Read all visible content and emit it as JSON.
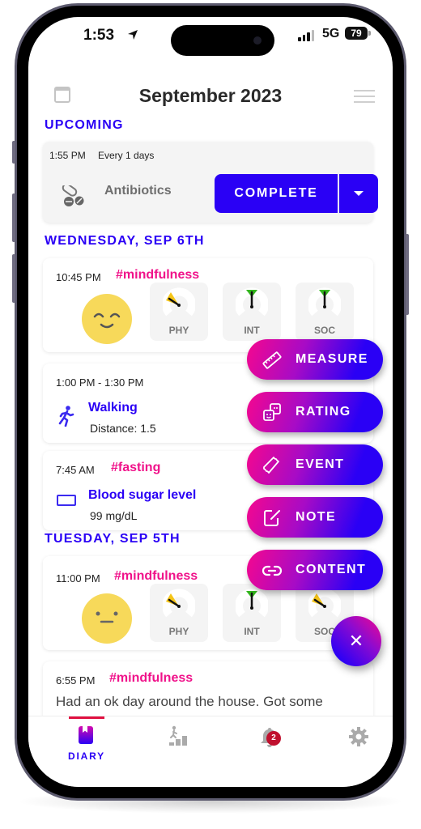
{
  "status_bar": {
    "time": "1:53",
    "network": "5G",
    "battery": "79"
  },
  "header": {
    "title": "September 2023"
  },
  "upcoming": {
    "label": "UPCOMING",
    "item": {
      "time": "1:55 PM",
      "frequency": "Every 1 days",
      "name": "Antibiotics",
      "icon": "pills-icon",
      "button_label": "COMPLETE"
    }
  },
  "days": [
    {
      "label": "WEDNESDAY, SEP 6TH",
      "entries": [
        {
          "type": "rating",
          "time": "10:45 PM",
          "tag": "#mindfulness",
          "mood": "happy",
          "gauges": [
            {
              "label": "PHY",
              "level": "low",
              "color": "#f5c518"
            },
            {
              "label": "INT",
              "level": "high",
              "color": "#33b51e"
            },
            {
              "label": "SOC",
              "level": "high",
              "color": "#33b51e"
            }
          ]
        },
        {
          "type": "event",
          "time": "1:00 PM - 1:30 PM",
          "title": "Walking",
          "detail": "Distance: 1.5",
          "icon": "walking-icon"
        },
        {
          "type": "measure",
          "time": "7:45 AM",
          "tag": "#fasting",
          "title": "Blood sugar level",
          "detail": "99 mg/dL",
          "icon": "glucose-meter-icon"
        }
      ]
    },
    {
      "label": "TUESDAY, SEP 5TH",
      "entries": [
        {
          "type": "rating",
          "time": "11:00 PM",
          "tag": "#mindfulness",
          "mood": "neutral",
          "gauges": [
            {
              "label": "PHY",
              "level": "low",
              "color": "#f5c518"
            },
            {
              "label": "INT",
              "level": "high",
              "color": "#33b51e"
            },
            {
              "label": "SOC",
              "level": "low",
              "color": "#f5c518"
            }
          ]
        },
        {
          "type": "note",
          "time": "6:55 PM",
          "tag": "#mindfulness",
          "text": "Had an ok day around the house. Got some"
        }
      ]
    }
  ],
  "fab_menu": {
    "items": [
      {
        "label": "MEASURE",
        "icon": "ruler-icon"
      },
      {
        "label": "RATING",
        "icon": "faces-icon"
      },
      {
        "label": "EVENT",
        "icon": "ticket-icon"
      },
      {
        "label": "NOTE",
        "icon": "edit-note-icon"
      },
      {
        "label": "CONTENT",
        "icon": "link-icon"
      }
    ],
    "close_label": "✕"
  },
  "tabbar": {
    "tabs": [
      {
        "label": "DIARY",
        "icon": "diary-icon",
        "active": true
      },
      {
        "label": "",
        "icon": "progress-icon",
        "active": false
      },
      {
        "label": "",
        "icon": "bell-icon",
        "active": false,
        "badge": "2"
      },
      {
        "label": "",
        "icon": "gear-icon",
        "active": false
      }
    ]
  },
  "colors": {
    "accent": "#2a00f5",
    "tag": "#f0128a",
    "badge": "#c0102e"
  }
}
